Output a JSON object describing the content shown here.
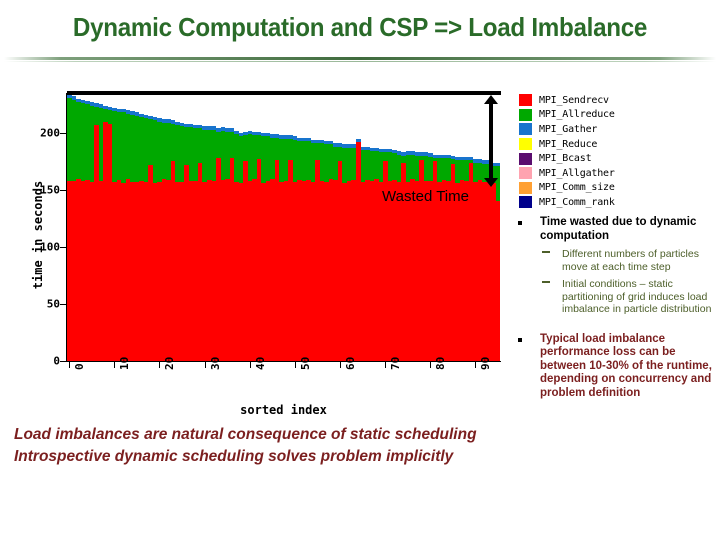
{
  "slide": {
    "title": "Dynamic Computation and CSP => Load Imbalance",
    "title_color": "#2a6b29",
    "accent_color": "#3f6b3d"
  },
  "annotations": {
    "wasted_time_label": "Wasted Time",
    "arrow_name": "wasted-time-double-arrow"
  },
  "legend": {
    "items": [
      {
        "label": "MPI_Sendrecv",
        "color": "#ff0000"
      },
      {
        "label": "MPI_Allreduce",
        "color": "#00a800"
      },
      {
        "label": "MPI_Gather",
        "color": "#1874cd"
      },
      {
        "label": "MPI_Reduce",
        "color": "#ffff00"
      },
      {
        "label": "MPI_Bcast",
        "color": "#5a0d6e"
      },
      {
        "label": "MPI_Allgather",
        "color": "#ffa3b0"
      },
      {
        "label": "MPI_Comm_size",
        "color": "#ffa033"
      },
      {
        "label": "MPI_Comm_rank",
        "color": "#00008b"
      }
    ]
  },
  "bullets": {
    "items": [
      {
        "text": "Time wasted due to dynamic computation",
        "color": "#000000",
        "subs": [
          "Different numbers of particles move at each time step",
          "Initial conditions – static partitioning of grid induces load imbalance in particle distribution"
        ]
      },
      {
        "text": "Typical load imbalance performance loss can be between 10-30% of the runtime, depending on concurrency and problem definition",
        "color": "#7b1f1f",
        "subs": []
      }
    ]
  },
  "caption": {
    "line1": "Load imbalances are natural consequence of static scheduling",
    "line2": "Introspective dynamic scheduling solves problem implicitly"
  },
  "chart_data": {
    "type": "bar",
    "stacked": true,
    "title": "",
    "xlabel": "sorted index",
    "ylabel": "time in seconds",
    "xlim": [
      0,
      96
    ],
    "ylim": [
      0,
      235
    ],
    "yticks": [
      0,
      50,
      100,
      150,
      200
    ],
    "xticks": [
      0,
      10,
      20,
      30,
      40,
      50,
      60,
      70,
      80,
      90
    ],
    "grid": false,
    "legend_position": "right",
    "categories": [
      0,
      1,
      2,
      3,
      4,
      5,
      6,
      7,
      8,
      9,
      10,
      11,
      12,
      13,
      14,
      15,
      16,
      17,
      18,
      19,
      20,
      21,
      22,
      23,
      24,
      25,
      26,
      27,
      28,
      29,
      30,
      31,
      32,
      33,
      34,
      35,
      36,
      37,
      38,
      39,
      40,
      41,
      42,
      43,
      44,
      45,
      46,
      47,
      48,
      49,
      50,
      51,
      52,
      53,
      54,
      55,
      56,
      57,
      58,
      59,
      60,
      61,
      62,
      63,
      64,
      65,
      66,
      67,
      68,
      69,
      70,
      71,
      72,
      73,
      74,
      75,
      76,
      77,
      78,
      79,
      80,
      81,
      82,
      83,
      84,
      85,
      86,
      87,
      88,
      89,
      90,
      91,
      92,
      93,
      94,
      95
    ],
    "series": [
      {
        "name": "MPI_Sendrecv",
        "color": "#ff0000",
        "values": [
          158,
          158,
          160,
          158,
          159,
          157,
          207,
          158,
          210,
          208,
          157,
          159,
          156,
          160,
          157,
          157,
          158,
          157,
          172,
          156,
          157,
          160,
          159,
          175,
          157,
          157,
          172,
          158,
          158,
          174,
          157,
          159,
          158,
          178,
          159,
          160,
          178,
          157,
          156,
          175,
          158,
          160,
          177,
          156,
          158,
          160,
          176,
          157,
          158,
          176,
          157,
          159,
          158,
          159,
          157,
          176,
          158,
          157,
          160,
          159,
          175,
          156,
          158,
          159,
          192,
          157,
          159,
          158,
          160,
          157,
          175,
          158,
          159,
          157,
          174,
          157,
          160,
          158,
          176,
          158,
          158,
          175,
          157,
          159,
          158,
          173,
          156,
          159,
          158,
          174,
          157,
          159,
          157,
          158,
          156,
          140
        ]
      },
      {
        "name": "MPI_Allreduce",
        "color": "#00a800",
        "values": [
          73,
          71,
          67,
          68,
          66,
          67,
          16,
          64,
          11,
          12,
          62,
          59,
          62,
          57,
          59,
          58,
          56,
          56,
          40,
          55,
          53,
          49,
          50,
          33,
          50,
          49,
          33,
          47,
          46,
          30,
          46,
          44,
          45,
          23,
          43,
          41,
          23,
          42,
          41,
          23,
          41,
          38,
          21,
          41,
          39,
          36,
          20,
          38,
          37,
          19,
          37,
          34,
          35,
          34,
          34,
          15,
          33,
          33,
          30,
          29,
          13,
          31,
          29,
          28,
          -8,
          28,
          26,
          26,
          24,
          26,
          8,
          25,
          23,
          24,
          6,
          24,
          21,
          22,
          4,
          22,
          21,
          3,
          21,
          19,
          20,
          4,
          20,
          17,
          18,
          2,
          17,
          15,
          16,
          15,
          15,
          31
        ]
      },
      {
        "name": "MPI_Gather",
        "color": "#1874cd",
        "values": [
          3,
          3,
          3,
          3,
          3,
          3,
          3,
          3,
          3,
          3,
          3,
          3,
          3,
          3,
          3,
          3,
          3,
          3,
          3,
          3,
          3,
          3,
          3,
          3,
          3,
          3,
          3,
          3,
          3,
          3,
          3,
          3,
          3,
          3,
          3,
          3,
          3,
          3,
          3,
          3,
          3,
          3,
          3,
          3,
          3,
          3,
          3,
          3,
          3,
          3,
          3,
          3,
          3,
          3,
          3,
          3,
          3,
          3,
          3,
          3,
          3,
          3,
          3,
          3,
          3,
          3,
          3,
          3,
          3,
          3,
          3,
          3,
          3,
          3,
          3,
          3,
          3,
          3,
          3,
          3,
          3,
          3,
          3,
          3,
          3,
          3,
          3,
          3,
          3,
          3,
          3,
          3,
          3,
          3,
          3,
          3
        ]
      }
    ],
    "notes": "Stacked bars of MPI call time per rank, sorted descending by total; white space above bars up to the black reference line is annotated as Wasted Time."
  }
}
